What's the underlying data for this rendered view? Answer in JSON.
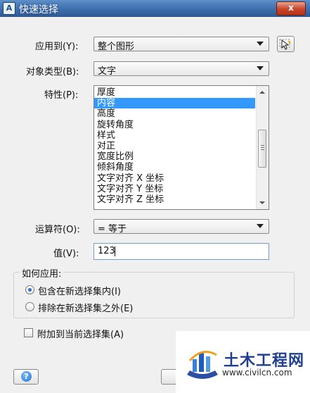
{
  "window": {
    "title": "快速选择",
    "close_label": "x"
  },
  "apply_to": {
    "label": "应用到(Y):",
    "value": "整个图形"
  },
  "object_type": {
    "label": "对象类型(B):",
    "value": "文字"
  },
  "properties": {
    "label": "特性(P):",
    "items": [
      "厚度",
      "内容",
      "高度",
      "旋转角度",
      "样式",
      "对正",
      "宽度比例",
      "倾斜角度",
      "文字对齐 X 坐标",
      "文字对齐 Y 坐标",
      "文字对齐 Z 坐标"
    ],
    "selected_index": 1
  },
  "operator": {
    "label": "运算符(O):",
    "value": "= 等于"
  },
  "value_field": {
    "label": "值(V):",
    "value": "123"
  },
  "how_to_apply": {
    "label": "如何应用:",
    "options": [
      "包含在新选择集内(I)",
      "排除在新选择集之外(E)"
    ],
    "selected_index": 0
  },
  "append": {
    "label": "附加到当前选择集(A)",
    "checked": false
  },
  "help_button": {
    "label": "?"
  },
  "watermark": {
    "title": "土木工程网",
    "url": "www.civilcn.com"
  },
  "colors": {
    "selection": "#3399ff",
    "titlebar": "#3f6fae",
    "close": "#c8442a"
  }
}
